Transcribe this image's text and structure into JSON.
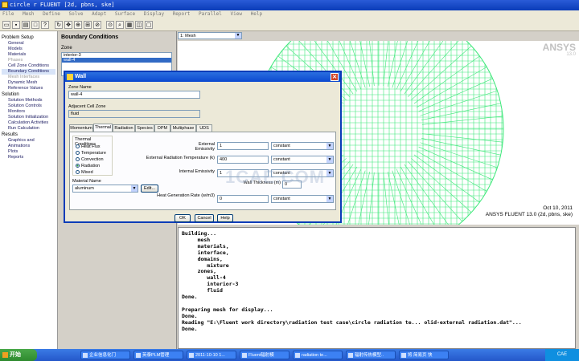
{
  "window": {
    "title": "circle r FLUENT  [2d, pbns, ske]"
  },
  "menu": [
    "File",
    "Mesh",
    "Define",
    "Solve",
    "Adapt",
    "Surface",
    "Display",
    "Report",
    "Parallel",
    "View",
    "Help"
  ],
  "nav": {
    "sections": [
      {
        "label": "Problem Setup",
        "items": [
          {
            "label": "General",
            "state": "normal"
          },
          {
            "label": "Models",
            "state": "normal"
          },
          {
            "label": "Materials",
            "state": "normal"
          },
          {
            "label": "Phases",
            "state": "disabled"
          },
          {
            "label": "Cell Zone Conditions",
            "state": "normal"
          },
          {
            "label": "Boundary Conditions",
            "state": "selected"
          },
          {
            "label": "Mesh Interfaces",
            "state": "disabled"
          },
          {
            "label": "Dynamic Mesh",
            "state": "normal"
          },
          {
            "label": "Reference Values",
            "state": "normal"
          }
        ]
      },
      {
        "label": "Solution",
        "items": [
          {
            "label": "Solution Methods",
            "state": "normal"
          },
          {
            "label": "Solution Controls",
            "state": "normal"
          },
          {
            "label": "Monitors",
            "state": "normal"
          },
          {
            "label": "Solution Initialization",
            "state": "normal"
          },
          {
            "label": "Calculation Activities",
            "state": "normal"
          },
          {
            "label": "Run Calculation",
            "state": "normal"
          }
        ]
      },
      {
        "label": "Results",
        "items": [
          {
            "label": "Graphics and Animations",
            "state": "normal"
          },
          {
            "label": "Plots",
            "state": "normal"
          },
          {
            "label": "Reports",
            "state": "normal"
          }
        ]
      }
    ]
  },
  "bc_panel": {
    "title": "Boundary Conditions",
    "zone_label": "Zone",
    "zones": [
      "interior-3",
      "wall-4"
    ],
    "selected_zone": "wall-4"
  },
  "graphics": {
    "view_selector": "1: Mesh",
    "logo": "ANSYS",
    "version": "13.0",
    "date": "Oct 10, 2011",
    "case_info": "ANSYS FLUENT 13.0 (2d, pbns, ske)",
    "mesh_color": "#3ee87a"
  },
  "dialog": {
    "title": "Wall",
    "zone_name_label": "Zone Name",
    "zone_name": "wall-4",
    "adjacent_label": "Adjacent Cell Zone",
    "adjacent_value": "fluid",
    "tabs": [
      "Momentum",
      "Thermal",
      "Radiation",
      "Species",
      "DPM",
      "Multiphase",
      "UDS"
    ],
    "active_tab": "Thermal",
    "thermal_conditions_label": "Thermal Conditions",
    "thermal_options": [
      "Heat Flux",
      "Temperature",
      "Convection",
      "Radiation",
      "Mixed"
    ],
    "thermal_selected": "Radiation",
    "external_emissivity": {
      "label": "External Emissivity",
      "value": "1",
      "method": "constant"
    },
    "external_radiation_temperature": {
      "label": "External Radiation Temperature (k)",
      "value": "400",
      "method": "constant"
    },
    "internal_emissivity": {
      "label": "Internal Emissivity",
      "value": "1",
      "method": "constant"
    },
    "wall_thickness": {
      "label": "Wall Thickness (m)",
      "value": "0"
    },
    "heat_generation_rate": {
      "label": "Heat Generation Rate (w/m3)",
      "value": "0",
      "method": "constant"
    },
    "material_name_label": "Material Name",
    "material_name": "aluminum",
    "edit_button": "Edit...",
    "ok_button": "OK",
    "cancel_button": "Cancel",
    "help_button": "Help"
  },
  "console": {
    "lines": [
      "Building...",
      "     mesh",
      "     materials,",
      "     interface,",
      "     domains,",
      "        mixture",
      "     zones,",
      "        wall-4",
      "        interior-3",
      "        fluid",
      "Done.",
      "",
      "Preparing mesh for display...",
      "Done.",
      "Reading \"E:\\Fluent work directory\\radiation test case\\circle radiation te... olid-external radiation.dat\"...",
      "Done."
    ]
  },
  "taskbar": {
    "start": "开始",
    "tasks": [
      "企业信息化门",
      "英泰PLM管理",
      "2011-10-10 1...",
      "Fluent辐射模",
      "radiation te...",
      "辐射传热模型..",
      "将 简易页 快"
    ],
    "tray": "CAE"
  },
  "watermark": "1CAE.COM"
}
